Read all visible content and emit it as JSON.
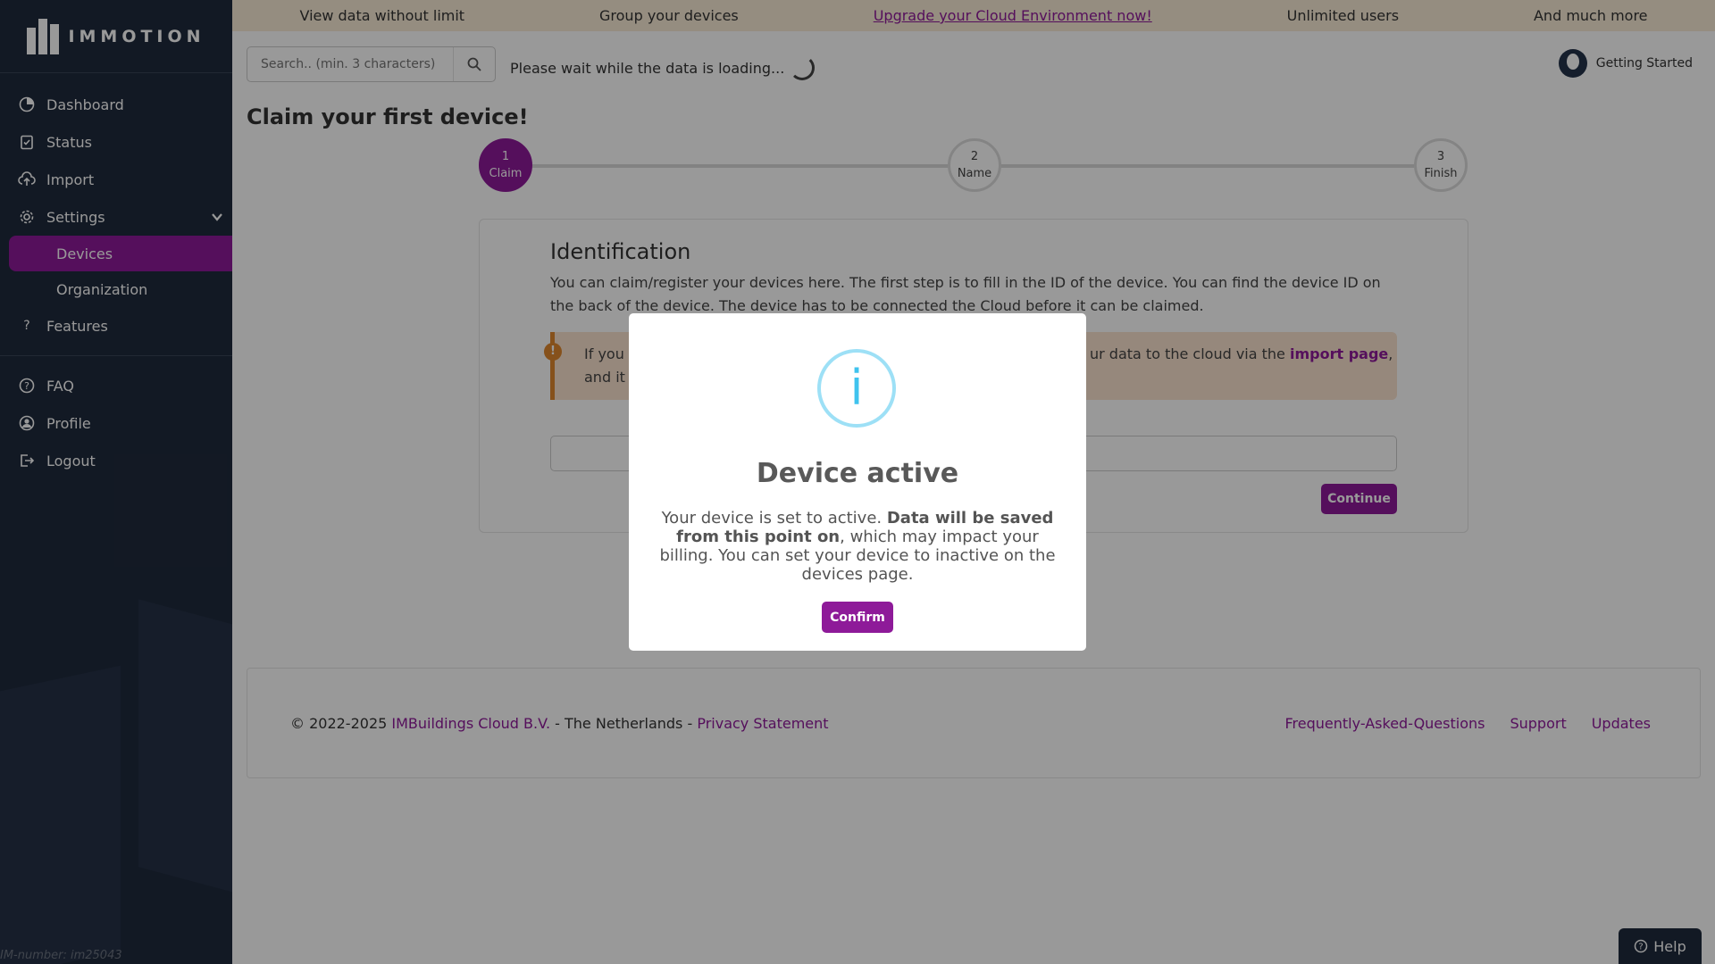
{
  "sidebar": {
    "logo_text": "IMMOTION",
    "items": [
      {
        "label": "Dashboard",
        "icon": "dashboard-icon"
      },
      {
        "label": "Status",
        "icon": "clipboard-icon"
      },
      {
        "label": "Import",
        "icon": "cloud-upload-icon"
      },
      {
        "label": "Settings",
        "icon": "gear-icon"
      }
    ],
    "subitems": [
      {
        "label": "Devices"
      },
      {
        "label": "Organization"
      }
    ],
    "features": {
      "label": "Features",
      "icon_glyph": "?"
    },
    "bottom_items": [
      {
        "label": "FAQ",
        "icon": "question-circle-icon"
      },
      {
        "label": "Profile",
        "icon": "user-circle-icon"
      },
      {
        "label": "Logout",
        "icon": "logout-icon"
      }
    ],
    "im_number": "IM-number: im25043"
  },
  "banner": {
    "items": [
      "View data without limit",
      "Group your devices",
      "Upgrade your Cloud Environment now!",
      "Unlimited users",
      "And much more"
    ]
  },
  "header": {
    "search_placeholder": "Search.. (min. 3 characters)",
    "loading_text": "Please wait while the data is loading...",
    "user_label": "Getting Started"
  },
  "main": {
    "title": "Claim your first device!",
    "steps": [
      {
        "number": "1",
        "label": "Claim"
      },
      {
        "number": "2",
        "label": "Name"
      },
      {
        "number": "3",
        "label": "Finish"
      }
    ],
    "card": {
      "heading": "Identification",
      "description": "You can claim/register your devices here. The first step is to fill in the ID of the device. You can find the device ID on the back of the device. The device has to be connected the Cloud before it can be claimed.",
      "alert_left_1": "If you h",
      "alert_left_2": "and it w",
      "alert_right_1": "ur data to the cloud via the ",
      "alert_link": "import page",
      "alert_right_end": ",",
      "continue_label": "Continue"
    }
  },
  "footer": {
    "copyright": "© 2022-2025 ",
    "company": "IMBuildings Cloud B.V.",
    "country": " - The Netherlands - ",
    "privacy": "Privacy Statement",
    "links": [
      "Frequently-Asked-Questions",
      "Support",
      "Updates"
    ]
  },
  "help": {
    "label": "Help"
  },
  "modal": {
    "icon_glyph": "i",
    "title": "Device active",
    "text_1": "Your device is set to active. ",
    "text_bold": "Data will be saved from this point on",
    "text_2": ", which may impact your billing. You can set your device to inactive on the devices page.",
    "confirm_label": "Confirm"
  },
  "colors": {
    "brand": "#8e1a99",
    "sidebar": "#1f2a3c",
    "info": "#3fc3ee",
    "warning": "#e0882d"
  }
}
